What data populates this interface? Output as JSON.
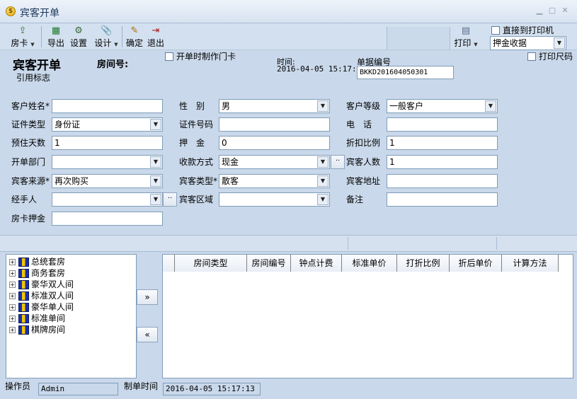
{
  "window": {
    "title": "宾客开单"
  },
  "toolbar": {
    "fangka": "房卡",
    "daochu": "导出",
    "shezhi": "设置",
    "sheji": "设计",
    "queding": "确定",
    "tuichu": "退出",
    "print": "打印",
    "direct_print_label": "直接到打印机",
    "print_template": "押金收据"
  },
  "header": {
    "title": "宾客开单",
    "room_no_label": "房间号:",
    "make_card_label": "开单时制作门卡",
    "time_label": "时间:",
    "time_value": "2016-04-05 15:17:16",
    "bill_no_label": "单据编号",
    "bill_no_value": "BKKD201604050301",
    "print_ruler_label": "打印尺码",
    "ref_flag": "引用标志"
  },
  "form": {
    "customer_name_label": "客户姓名*",
    "customer_name": "",
    "gender_label": "性　别",
    "gender": "男",
    "customer_level_label": "客户等级",
    "customer_level": "一般客户",
    "id_type_label": "证件类型",
    "id_type": "身份证",
    "id_no_label": "证件号码",
    "id_no": "",
    "phone_label": "电　话",
    "phone": "",
    "stay_days_label": "预住天数",
    "stay_days": "1",
    "deposit_label": "押　金",
    "deposit": "0",
    "discount_label": "折扣比例",
    "discount": "1",
    "dept_label": "开单部门",
    "dept": "",
    "pay_method_label": "收款方式",
    "pay_method": "现金",
    "guest_count_label": "宾客人数",
    "guest_count": "1",
    "source_label": "宾客来源*",
    "source": "再次购买",
    "guest_type_label": "宾客类型*",
    "guest_type": "散客",
    "address_label": "宾客地址",
    "address": "",
    "handler_label": "经手人",
    "handler": "",
    "area_label": "宾客区域",
    "area": "",
    "remark_label": "备注",
    "remark": "",
    "card_deposit_label": "房卡押金",
    "card_deposit": ""
  },
  "tree": {
    "items": [
      "总统套房",
      "商务套房",
      "豪华双人间",
      "标准双人间",
      "豪华单人间",
      "标准单间",
      "棋牌房间"
    ]
  },
  "buttons": {
    "add": "»",
    "remove": "«"
  },
  "grid": {
    "columns": [
      "房间类型",
      "房间编号",
      "钟点计费",
      "标准单价",
      "打折比例",
      "折后单价",
      "计算方法"
    ]
  },
  "status": {
    "operator_label": "操作员",
    "operator": "Admin",
    "made_time_label": "制单时间",
    "made_time": "2016-04-05 15:17:13"
  }
}
